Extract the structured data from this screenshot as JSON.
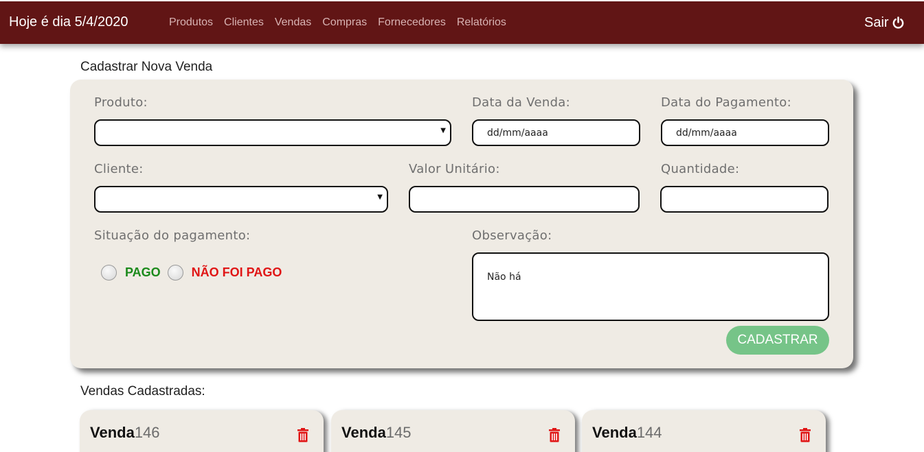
{
  "header": {
    "date_text": "Hoje é dia 5/4/2020",
    "nav": [
      "Produtos",
      "Clientes",
      "Vendas",
      "Compras",
      "Fornecedores",
      "Relatórios"
    ],
    "exit_label": "Sair",
    "exit_icon": "power-icon"
  },
  "form": {
    "title": "Cadastrar Nova Venda",
    "produto_label": "Produto:",
    "produto_value": "",
    "data_venda_label": "Data da Venda:",
    "data_venda_value": "dd/mm/aaaa",
    "data_pagamento_label": "Data do Pagamento:",
    "data_pagamento_value": "dd/mm/aaaa",
    "cliente_label": "Cliente:",
    "cliente_value": "",
    "valor_label": "Valor Unitário:",
    "valor_value": "",
    "quantidade_label": "Quantidade:",
    "quantidade_value": "",
    "situacao_label": "Situação do pagamento:",
    "pago_label": "PAGO",
    "nao_pago_label": "NÃO FOI PAGO",
    "observacao_label": "Observação:",
    "observacao_value": "Não há",
    "submit_label": "CADASTRAR"
  },
  "sales": {
    "title": "Vendas Cadastradas:",
    "items": [
      {
        "label": "Venda",
        "number": "146"
      },
      {
        "label": "Venda",
        "number": "145"
      },
      {
        "label": "Venda",
        "number": "144"
      }
    ]
  },
  "colors": {
    "navbar": "#611515",
    "card": "#efebe4",
    "pago": "#1b8a1b",
    "nao_pago": "#e01515",
    "submit": "#76c488",
    "trash": "#e01515"
  }
}
